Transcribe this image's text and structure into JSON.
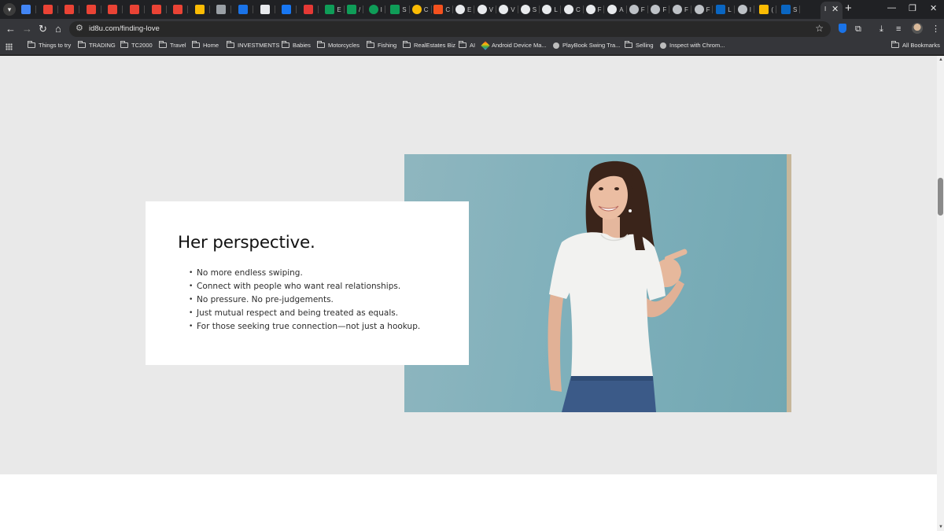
{
  "browser": {
    "tabs": [
      {
        "icon": "sheets-icon",
        "label": "",
        "color": "#4285f4"
      },
      {
        "icon": "gmail-icon",
        "label": "",
        "color": "#ea4335"
      },
      {
        "icon": "gmail-icon",
        "label": "",
        "color": "#ea4335"
      },
      {
        "icon": "gmail-icon",
        "label": "",
        "color": "#ea4335"
      },
      {
        "icon": "gmail-icon",
        "label": "",
        "color": "#ea4335"
      },
      {
        "icon": "gmail-icon",
        "label": "",
        "color": "#ea4335"
      },
      {
        "icon": "gmail-icon",
        "label": "",
        "color": "#ea4335"
      },
      {
        "icon": "gmail-icon",
        "label": "",
        "color": "#ea4335"
      },
      {
        "icon": "drive-icon",
        "label": "",
        "color": "#fbbc04"
      },
      {
        "icon": "audio-icon",
        "label": "",
        "color": "#9aa0a6"
      },
      {
        "icon": "tc2000-icon",
        "label": "",
        "color": "#1a73e8"
      },
      {
        "icon": "shield-icon",
        "label": "",
        "color": "#e8eaed"
      },
      {
        "icon": "facebook-icon",
        "label": "",
        "color": "#1877f2"
      },
      {
        "icon": "ig-icon",
        "label": "",
        "color": "#e53935"
      },
      {
        "icon": "sheets-plus-icon",
        "label": "E",
        "color": "#0f9d58"
      },
      {
        "icon": "sheets-plus-icon",
        "label": "/",
        "color": "#0f9d58"
      },
      {
        "icon": "plus-circle-icon",
        "label": "I",
        "color": "#0f9d58"
      },
      {
        "icon": "sheets-plus-icon",
        "label": "S",
        "color": "#0f9d58"
      },
      {
        "icon": "coin-icon",
        "label": "C",
        "color": "#fbbc04"
      },
      {
        "icon": "spark-icon",
        "label": "C",
        "color": "#f4511e"
      },
      {
        "icon": "github-icon",
        "label": "E",
        "color": "#e8eaed"
      },
      {
        "icon": "github-icon",
        "label": "V",
        "color": "#e8eaed"
      },
      {
        "icon": "github-icon",
        "label": "V",
        "color": "#e8eaed"
      },
      {
        "icon": "github-icon",
        "label": "S",
        "color": "#e8eaed"
      },
      {
        "icon": "github-icon",
        "label": "L",
        "color": "#e8eaed"
      },
      {
        "icon": "github-icon",
        "label": "C",
        "color": "#e8eaed"
      },
      {
        "icon": "github-icon",
        "label": "F",
        "color": "#e8eaed"
      },
      {
        "icon": "github-icon",
        "label": "A",
        "color": "#e8eaed"
      },
      {
        "icon": "globe-icon",
        "label": "F",
        "color": "#bdc1c6"
      },
      {
        "icon": "globe-icon",
        "label": "F",
        "color": "#bdc1c6"
      },
      {
        "icon": "globe-icon",
        "label": "F",
        "color": "#bdc1c6"
      },
      {
        "icon": "globe-icon",
        "label": "F",
        "color": "#bdc1c6"
      },
      {
        "icon": "linkedin-icon",
        "label": "L",
        "color": "#0a66c2"
      },
      {
        "icon": "globe-icon",
        "label": "I",
        "color": "#bdc1c6"
      },
      {
        "icon": "flag-icon",
        "label": "(",
        "color": "#fbbc04"
      },
      {
        "icon": "linkedin-icon",
        "label": "S",
        "color": "#0a66c2"
      }
    ],
    "active_tab": {
      "label": "I",
      "close": "✕"
    },
    "new_tab": "+",
    "window_controls": {
      "minimize": "—",
      "restore": "❐",
      "close": "✕"
    },
    "nav": {
      "back": "←",
      "forward": "→",
      "reload": "↻",
      "home": "⌂"
    },
    "url": "id8u.com/finding-love",
    "bookmarks": [
      {
        "type": "folder",
        "label": "Things to try"
      },
      {
        "type": "folder",
        "label": "TRADING"
      },
      {
        "type": "folder",
        "label": "TC2000"
      },
      {
        "type": "folder",
        "label": "Travel"
      },
      {
        "type": "folder",
        "label": "Home"
      },
      {
        "type": "folder",
        "label": "INVESTMENTS"
      },
      {
        "type": "folder",
        "label": "Babies"
      },
      {
        "type": "folder",
        "label": "Motorcycles"
      },
      {
        "type": "folder",
        "label": "Fishing"
      },
      {
        "type": "folder",
        "label": "RealEstates Biz"
      },
      {
        "type": "folder",
        "label": "AI"
      },
      {
        "type": "link",
        "label": "Android Device Ma..."
      },
      {
        "type": "link",
        "label": "PlayBook Swing Tra..."
      },
      {
        "type": "folder",
        "label": "Selling"
      },
      {
        "type": "link",
        "label": "Inspect with Chrom..."
      }
    ],
    "all_bookmarks": "All Bookmarks"
  },
  "content": {
    "heading": "Her perspective.",
    "points": [
      "No more endless swiping.",
      "Connect with people who want real relationships.",
      "No pressure. No pre-judgements.",
      "Just mutual respect and being treated as equals.",
      "For those seeking true connection—not just a hookup."
    ]
  },
  "colors": {
    "page_bg": "#e9e9e9",
    "card_bg": "#ffffff",
    "photo_bg": "#80b1bb",
    "chrome_dark": "#35363a"
  }
}
